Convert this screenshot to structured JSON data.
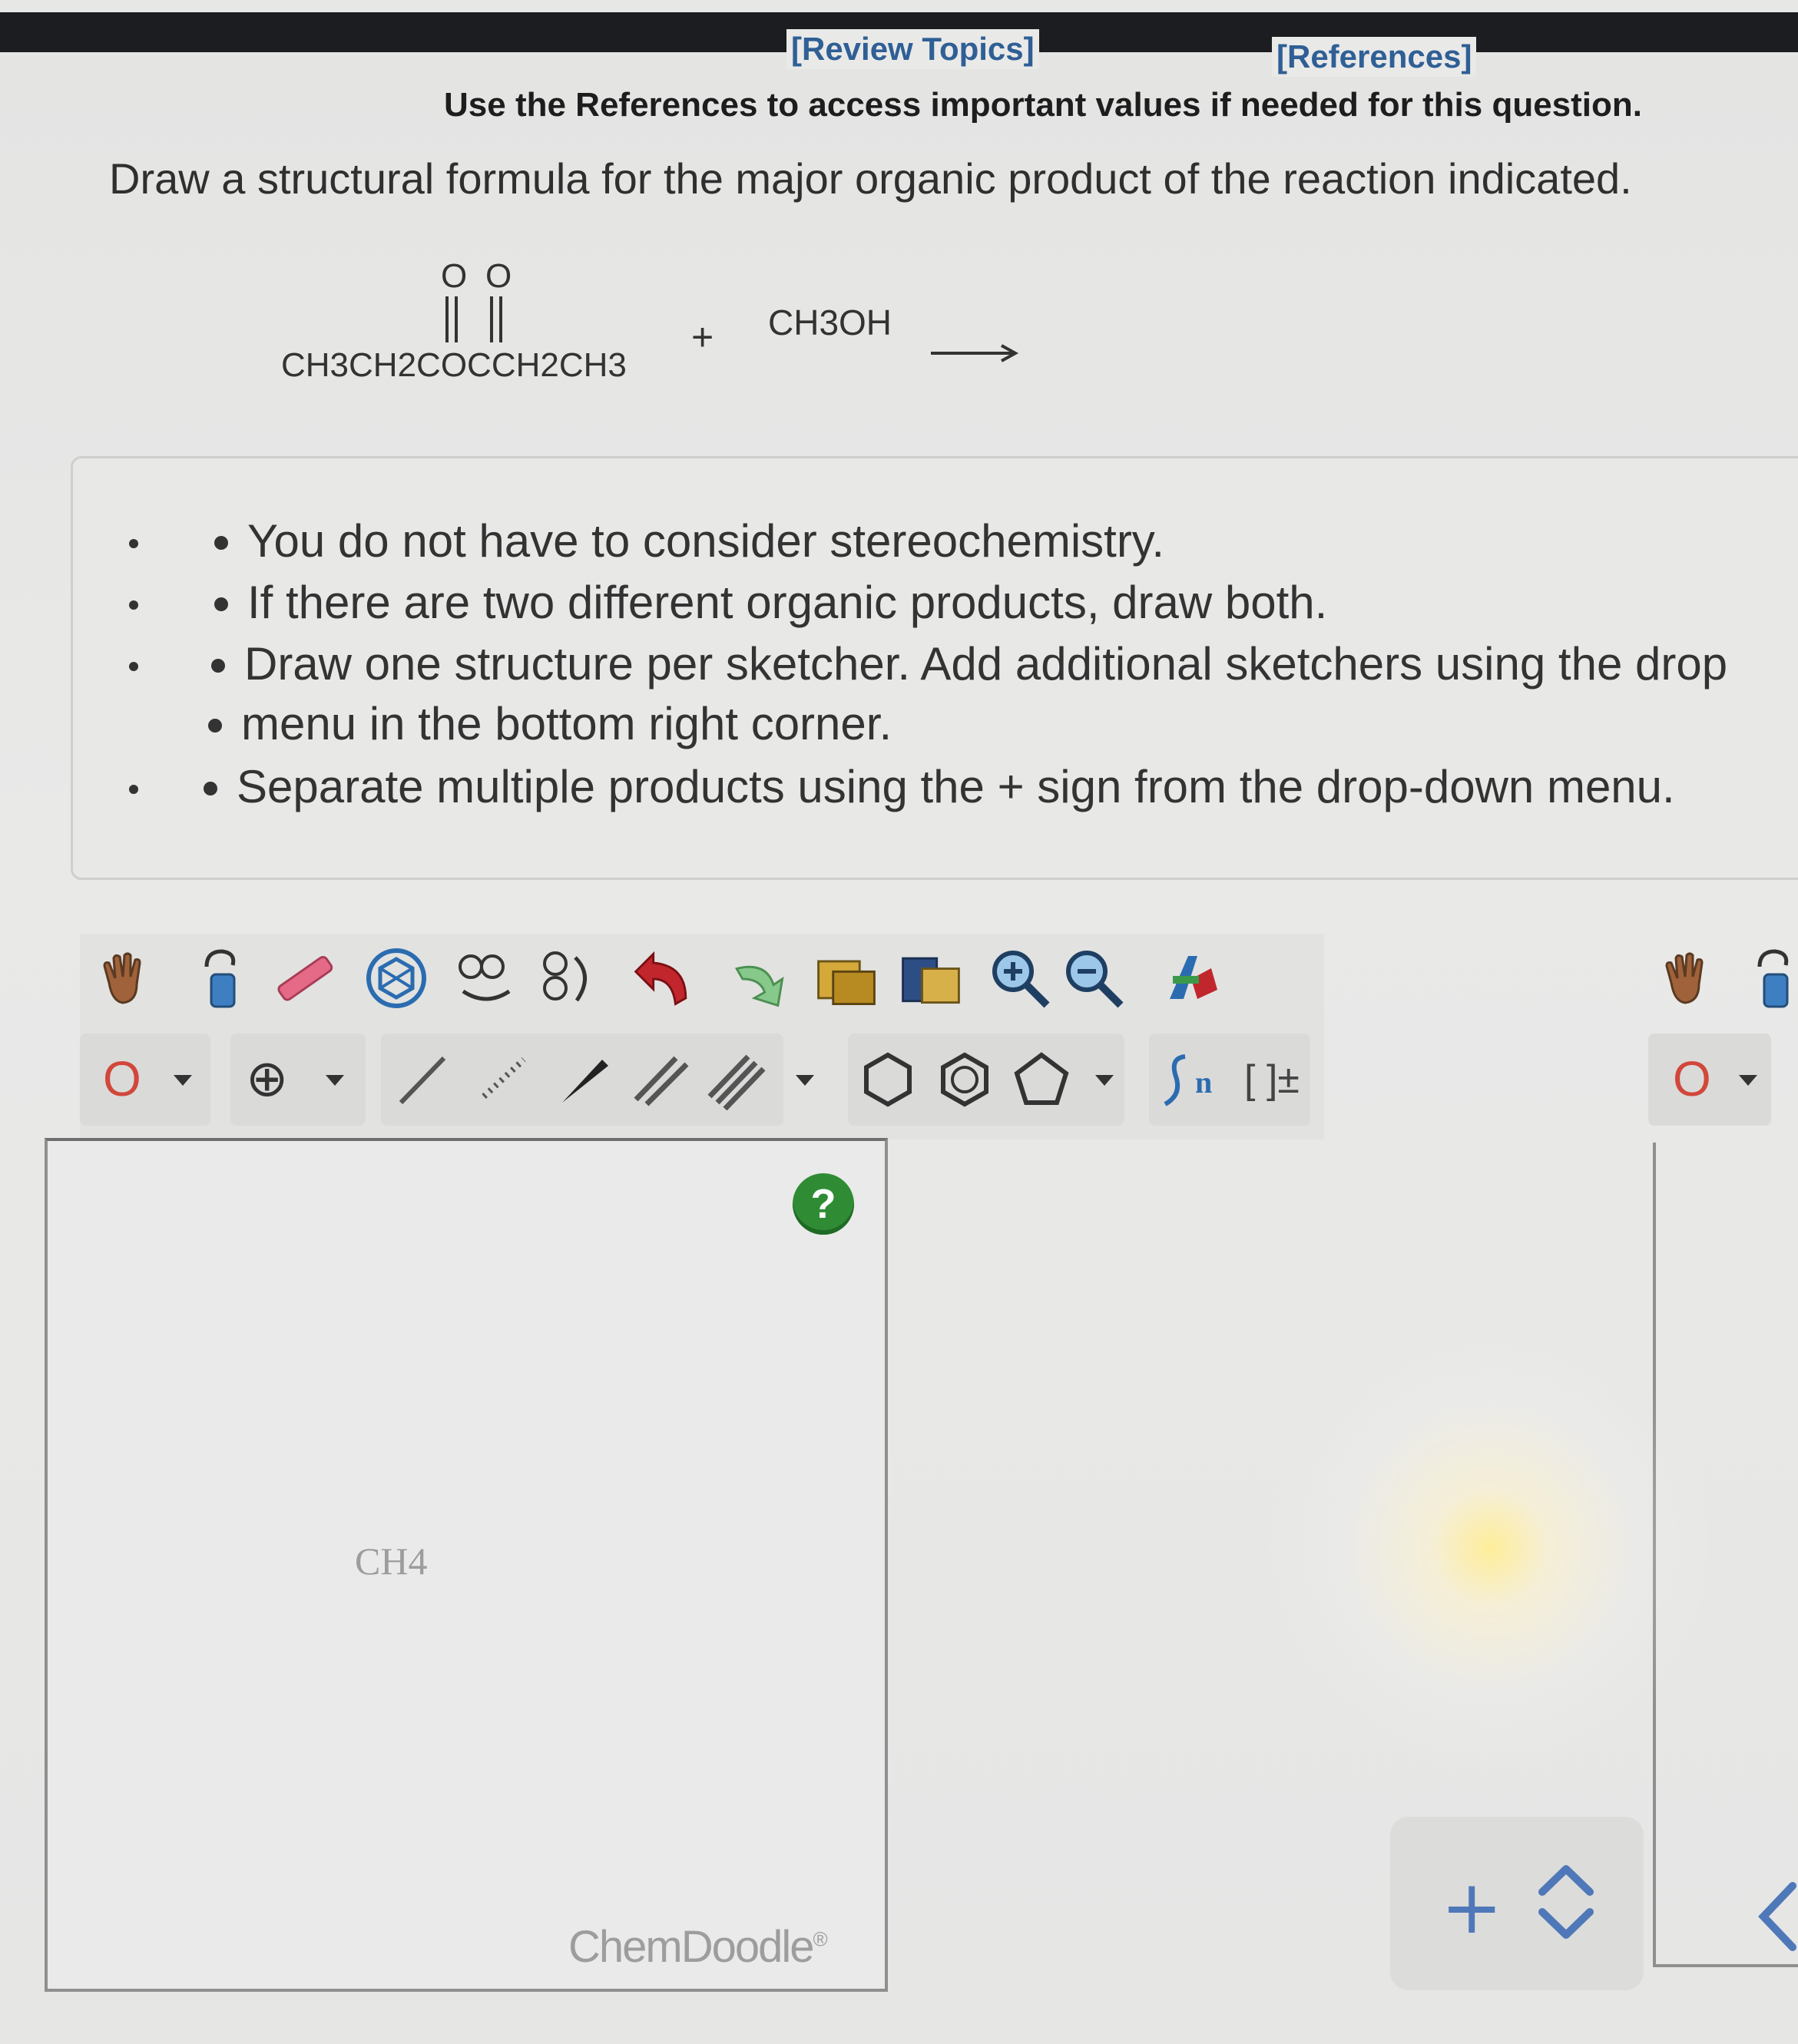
{
  "header": {
    "review_topics": "[Review Topics]",
    "references": "[References]"
  },
  "reference_note": "Use the References to access important values if needed for this question.",
  "question": "Draw a structural formula for the major organic product of the reaction indicated.",
  "reaction": {
    "reactant1": "CH3CH2COCCH2CH3",
    "reactant1_carbonyl_o": "O",
    "reactant2": "CH3OH",
    "plus": "+",
    "arrow": "→"
  },
  "instructions": [
    "You do not have to consider stereochemistry.",
    "If there are two different organic products, draw both.",
    "Draw one structure per sketcher. Add additional sketchers using the drop",
    "menu in the bottom right corner.",
    "Separate multiple products using the + sign from the drop-down menu."
  ],
  "toolbar": {
    "atom_select_value": "O",
    "charge_symbol": "⊕",
    "sn_label": "n",
    "bracket_label": "[ ]±"
  },
  "sketcher": {
    "content_label": "CH4",
    "help_label": "?",
    "brand": "ChemDoodle",
    "brand_mark": "®"
  },
  "sketcher2": {
    "atom_select_value": "O"
  },
  "add_controls": {
    "plus": "+"
  }
}
